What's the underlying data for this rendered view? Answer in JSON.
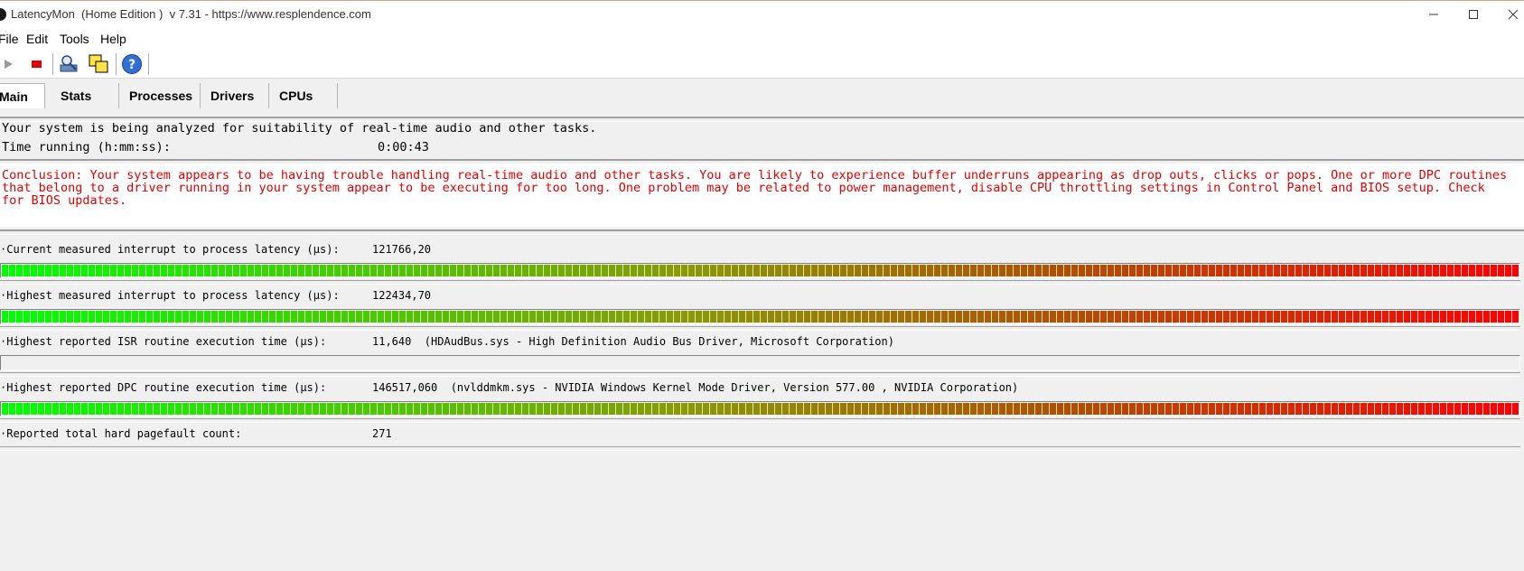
{
  "window": {
    "title": "LatencyMon  (Home Edition )  v 7.31 - https://www.resplendence.com",
    "minimize_icon": "minimize-icon",
    "maximize_icon": "maximize-icon",
    "close_icon": "close-icon"
  },
  "menu": {
    "items": [
      "File",
      "Edit",
      "Tools",
      "Help"
    ]
  },
  "toolbar": {
    "buttons": [
      "play-icon",
      "stop-icon",
      "analyze-icon",
      "windows-icon",
      "help-icon"
    ]
  },
  "tabs": {
    "items": [
      "Main",
      "Stats",
      "Processes",
      "Drivers",
      "CPUs"
    ],
    "active": "Main"
  },
  "status": {
    "analyzing_text": "Your system is being analyzed for suitability of real-time audio and other tasks.",
    "time_label": "Time running (h:mm:ss):",
    "time_value": "0:00:43"
  },
  "conclusion": {
    "text": "Conclusion: Your system appears to be having trouble handling real-time audio and other tasks. You are likely to experience buffer underruns appearing as drop outs, clicks or pops. One or more DPC routines that belong to a driver running in your system appear to be executing for too long. One problem may be related to power management, disable CPU throttling settings in Control Panel and BIOS setup. Check for BIOS updates.",
    "color": "#e00000"
  },
  "metrics": [
    {
      "label": "·Current measured interrupt to process latency (µs):",
      "value": "121766,20",
      "level": 1.0
    },
    {
      "label": "·Highest measured interrupt to process latency (µs):",
      "value": "122434,70",
      "level": 1.0
    },
    {
      "label": "·Highest reported ISR routine execution time (µs):",
      "value": "11,640  (HDAudBus.sys - High Definition Audio Bus Driver, Microsoft Corporation)",
      "level": 0.0
    },
    {
      "label": "·Highest reported DPC routine execution time (µs):",
      "value": "146517,060  (nvlddmkm.sys - NVIDIA Windows Kernel Mode Driver, Version 577.00 , NVIDIA Corporation)",
      "level": 1.0
    },
    {
      "label": "·Reported total hard pagefault count:",
      "value": "271",
      "level": null
    }
  ],
  "colors": {
    "meter_start": "#00ff00",
    "meter_mid": "#8a9a00",
    "meter_late": "#b05000",
    "meter_end": "#ff0000"
  }
}
